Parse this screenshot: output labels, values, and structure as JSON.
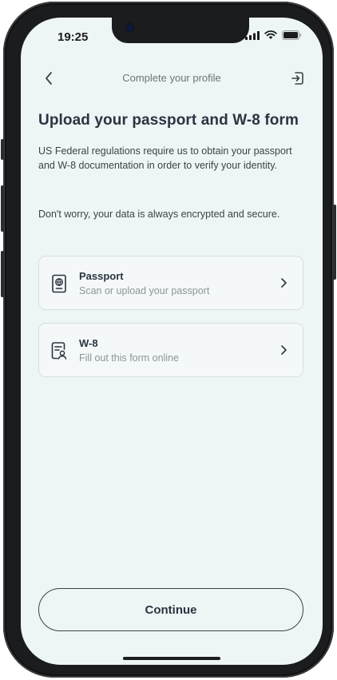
{
  "status_bar": {
    "time": "19:25"
  },
  "header": {
    "title": "Complete your profile"
  },
  "main": {
    "title": "Upload your passport and W-8 form",
    "paragraph1": "US Federal regulations require us to obtain your passport and W-8 documentation in order to verify your identity.",
    "paragraph2": "Don't worry, your data is always encrypted and secure."
  },
  "cards": [
    {
      "title": "Passport",
      "subtitle": "Scan or upload your passport",
      "icon": "passport-icon"
    },
    {
      "title": "W-8",
      "subtitle": "Fill out this form online",
      "icon": "form-icon"
    }
  ],
  "footer": {
    "continue_label": "Continue"
  },
  "colors": {
    "background": "#eef5f5",
    "text": "#2a3540",
    "muted": "#8a9598",
    "border": "#d6dfe0"
  }
}
